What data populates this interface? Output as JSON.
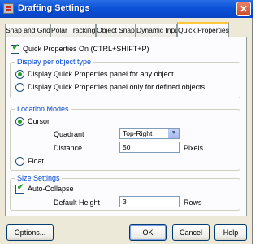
{
  "window": {
    "title": "Drafting Settings",
    "close_symbol": "✕"
  },
  "tabs": [
    {
      "label": "Snap and Grid"
    },
    {
      "label": "Polar Tracking"
    },
    {
      "label": "Object Snap"
    },
    {
      "label": "Dynamic Input"
    },
    {
      "label": "Quick Properties",
      "active": true
    }
  ],
  "quick_properties_on": {
    "label": "Quick Properties On (CTRL+SHIFT+P)",
    "checked": true
  },
  "display_per_object_type": {
    "title": "Display per object type",
    "options": [
      {
        "label": "Display Quick Properties panel for any object",
        "selected": true
      },
      {
        "label": "Display Quick Properties panel only for defined objects",
        "selected": false
      }
    ]
  },
  "location_modes": {
    "title": "Location Modes",
    "cursor_label": "Cursor",
    "cursor_selected": true,
    "quadrant_label": "Quadrant",
    "quadrant_value": "Top-Right",
    "distance_label": "Distance",
    "distance_value": "50",
    "distance_unit": "Pixels",
    "float_label": "Float",
    "float_selected": false
  },
  "size_settings": {
    "title": "Size Settings",
    "auto_collapse_label": "Auto-Collapse",
    "auto_collapse_checked": true,
    "default_height_label": "Default Height",
    "default_height_value": "3",
    "default_height_unit": "Rows"
  },
  "buttons": {
    "options": "Options...",
    "ok": "OK",
    "cancel": "Cancel",
    "help": "Help"
  },
  "colors": {
    "title_bar": "#0b52d8",
    "dialog_background": "#ece9d8",
    "group_title": "#0046d5",
    "active_tab_highlight": "#ffc73c",
    "check_mark": "#21a121"
  }
}
